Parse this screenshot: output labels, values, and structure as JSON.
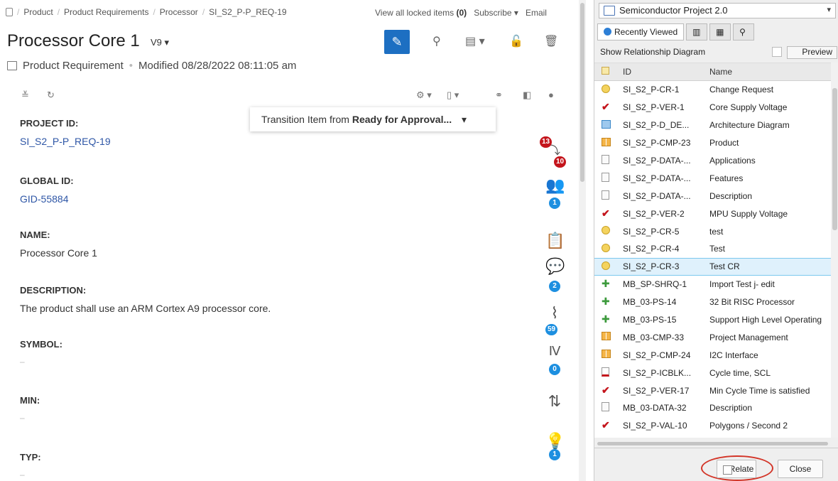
{
  "breadcrumb": [
    "Product",
    "Product Requirements",
    "Processor",
    "SI_S2_P-P_REQ-19"
  ],
  "top_links": {
    "locked_prefix": "View all locked items",
    "locked_count": "(0)",
    "subscribe": "Subscribe",
    "email": "Email"
  },
  "item": {
    "title": "Processor Core 1",
    "version": "V9",
    "type": "Product Requirement",
    "modified": "Modified 08/28/2022 08:11:05 am"
  },
  "transition": {
    "prefix": "Transition Item from ",
    "state": "Ready for Approval..."
  },
  "fields": [
    {
      "label": "PROJECT ID:",
      "value": "SI_S2_P-P_REQ-19"
    },
    {
      "label": "GLOBAL ID:",
      "value": "GID-55884"
    },
    {
      "label": "NAME:",
      "value": "Processor Core 1"
    },
    {
      "label": "DESCRIPTION:",
      "value": "The product shall use an ARM Cortex A9 processor core."
    },
    {
      "label": "SYMBOL:",
      "value": "–"
    },
    {
      "label": "MIN:",
      "value": "–"
    },
    {
      "label": "TYP:",
      "value": "–"
    }
  ],
  "rail_badges": {
    "relationships_upstream": "13",
    "relationships_downstream": "10",
    "users": "1",
    "comments": "2",
    "activity": "59",
    "versions": "0",
    "suggestions": "1"
  },
  "right": {
    "project": "Semiconductor Project 2.0",
    "tab_recent": "Recently Viewed",
    "show_diagram": "Show Relationship Diagram",
    "preview": "Preview",
    "headers": {
      "id": "ID",
      "name": "Name"
    },
    "rows": [
      {
        "icon": "change-request",
        "id": "SI_S2_P-CR-1",
        "name": "Change Request"
      },
      {
        "icon": "verification",
        "id": "SI_S2_P-VER-1",
        "name": "Core Supply Voltage"
      },
      {
        "icon": "diagram",
        "id": "SI_S2_P-D_DE...",
        "name": "Architecture Diagram"
      },
      {
        "icon": "component",
        "id": "SI_S2_P-CMP-23",
        "name": "Product"
      },
      {
        "icon": "data",
        "id": "SI_S2_P-DATA-...",
        "name": "Applications"
      },
      {
        "icon": "data",
        "id": "SI_S2_P-DATA-...",
        "name": "Features"
      },
      {
        "icon": "data",
        "id": "SI_S2_P-DATA-...",
        "name": "Description"
      },
      {
        "icon": "verification",
        "id": "SI_S2_P-VER-2",
        "name": "MPU Supply Voltage"
      },
      {
        "icon": "change-request",
        "id": "SI_S2_P-CR-5",
        "name": "test"
      },
      {
        "icon": "change-request",
        "id": "SI_S2_P-CR-4",
        "name": "Test"
      },
      {
        "icon": "change-request",
        "id": "SI_S2_P-CR-3",
        "name": "Test CR"
      },
      {
        "icon": "puzzle",
        "id": "MB_SP-SHRQ-1",
        "name": "Import Test j- edit"
      },
      {
        "icon": "puzzle",
        "id": "MB_03-PS-14",
        "name": "32 Bit RISC Processor"
      },
      {
        "icon": "puzzle",
        "id": "MB_03-PS-15",
        "name": "Support High Level Operating"
      },
      {
        "icon": "component",
        "id": "MB_03-CMP-33",
        "name": "Project Management"
      },
      {
        "icon": "component",
        "id": "SI_S2_P-CMP-24",
        "name": "I2C Interface"
      },
      {
        "icon": "page",
        "id": "SI_S2_P-ICBLK...",
        "name": "Cycle time, SCL"
      },
      {
        "icon": "verification",
        "id": "SI_S2_P-VER-17",
        "name": "Min Cycle Time is satisfied"
      },
      {
        "icon": "data",
        "id": "MB_03-DATA-32",
        "name": "Description"
      },
      {
        "icon": "verification",
        "id": "SI_S2_P-VAL-10",
        "name": "Polygons / Second 2"
      }
    ],
    "selected_row": 10,
    "relate": "Relate",
    "close": "Close"
  }
}
